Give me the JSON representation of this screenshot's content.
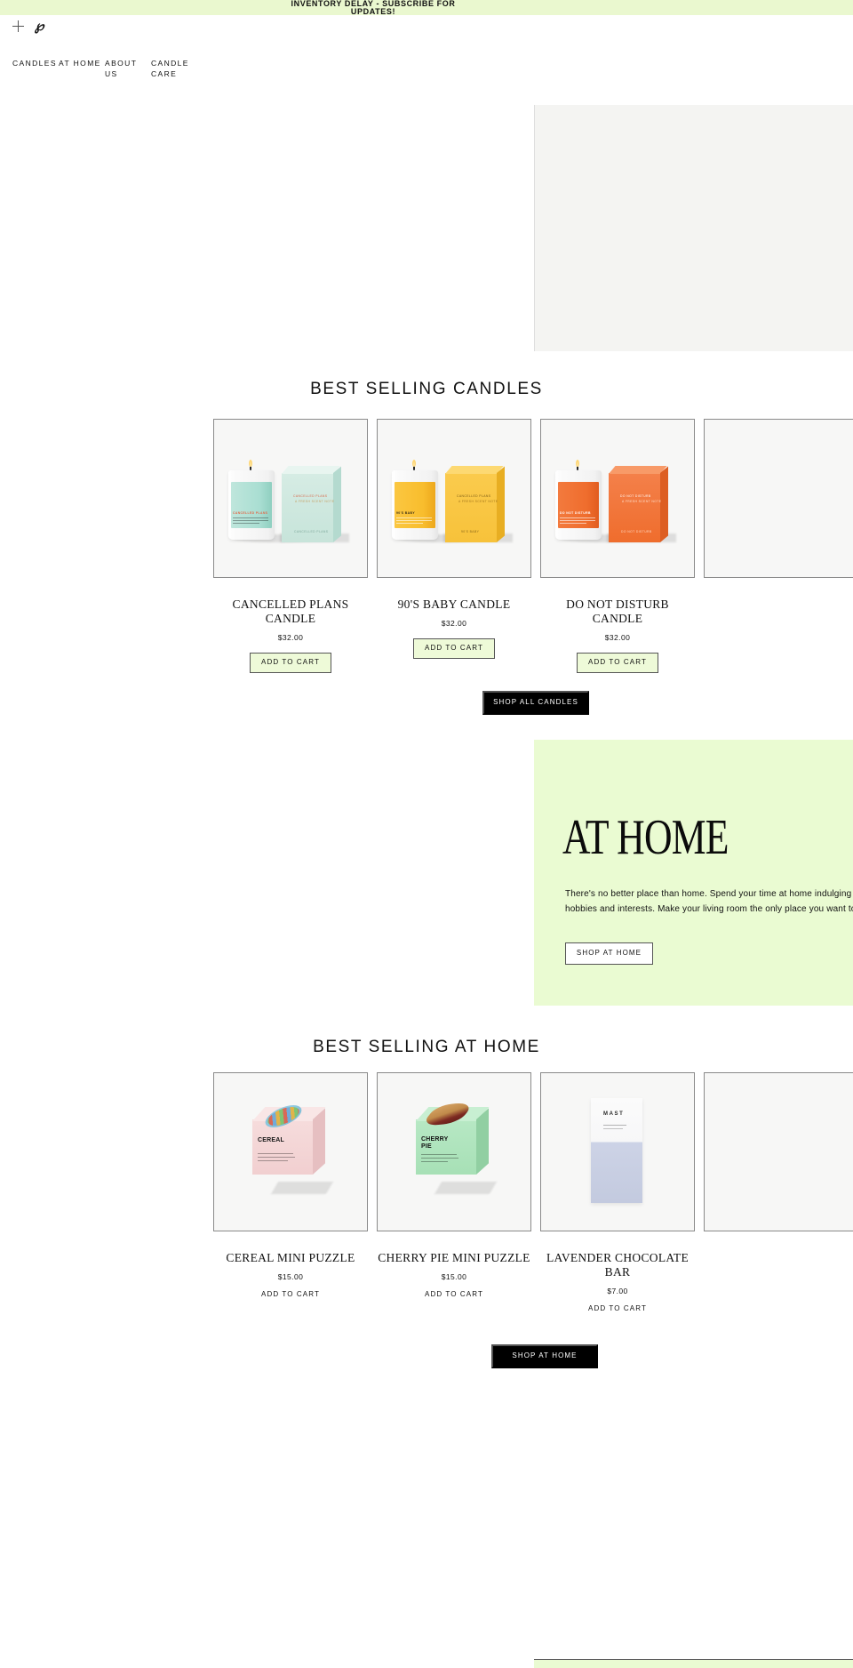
{
  "announcement": {
    "text": "INVENTORY DELAY - SUBSCRIBE FOR UPDATES!"
  },
  "utility": {
    "menu_icon": "plus-icon",
    "pinterest_icon": "pinterest-icon",
    "pinterest_glyph": "ƒ"
  },
  "nav": {
    "items": [
      {
        "label": "CANDLES"
      },
      {
        "label": "AT HOME"
      },
      {
        "label": "ABOUT US"
      },
      {
        "label": "CANDLE CARE"
      }
    ]
  },
  "sections": [
    {
      "heading": "BEST SELLING CANDLES",
      "cta": {
        "label": "SHOP ALL CANDLES"
      },
      "products": [
        {
          "title": "CANCELLED PLANS CANDLE",
          "price": "$32.00",
          "add_label": "ADD TO CART",
          "label_text": "CANCELLED PLANS",
          "box_text": "CANCELLED PLANS"
        },
        {
          "title": "90'S BABY CANDLE",
          "price": "$32.00",
          "add_label": "ADD TO CART",
          "label_text": "90'S BABY",
          "box_text": "CANCELLED PLANS"
        },
        {
          "title": "DO NOT DISTURB CANDLE",
          "price": "$32.00",
          "add_label": "ADD TO CART",
          "label_text": "DO NOT DISTURB",
          "box_text": "DO NOT DISTURB"
        },
        {
          "title": "",
          "price": "",
          "add_label": "",
          "label_text": "",
          "box_text": ""
        }
      ]
    },
    {
      "heading": "BEST SELLING AT HOME",
      "cta": {
        "label": "SHOP AT HOME"
      },
      "products": [
        {
          "title": "CEREAL MINI PUZZLE",
          "price": "$15.00",
          "add_label": "ADD TO CART",
          "box_title": "CEREAL",
          "box_desc": "food-shaped jigsaw puzzle more than 70 pieces ready in 30 minutes"
        },
        {
          "title": "CHERRY PIE MINI PUZZLE",
          "price": "$15.00",
          "add_label": "ADD TO CART",
          "box_title": "CHERRY PIE",
          "box_desc": "miniature shaped jigsaw puzzle more than 70 pieces limited edition"
        },
        {
          "title": "LAVENDER CHOCOLATE BAR",
          "price": "$7.00",
          "add_label": "ADD TO CART",
          "box_title": "MAST",
          "box_desc": "lavender chocolate"
        },
        {
          "title": "",
          "price": "",
          "add_label": "",
          "box_title": "",
          "box_desc": ""
        }
      ]
    }
  ],
  "promo": {
    "heading": "AT HOME",
    "body": "There's no better place than home. Spend your time at home indulging in your most recent hobbies and interests. Make your living room the only place you want to be.",
    "button_label": "SHOP AT HOME"
  },
  "colors": {
    "accent_green": "#eafbd2",
    "announce_green": "#eaf8cf",
    "button_green": "#eefad8",
    "dark": "#000000"
  }
}
